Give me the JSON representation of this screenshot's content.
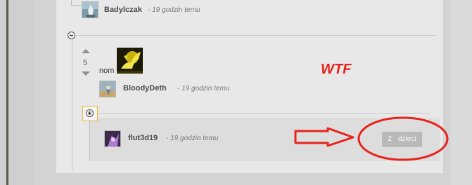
{
  "comments": {
    "top": {
      "author": "Badylczak",
      "time": "- 19 godzin temu"
    },
    "parent": {
      "score": "5",
      "text": "nom",
      "author": "BloodyDeth",
      "time": "- 19 godzin temu"
    },
    "child": {
      "author": "flut3d19",
      "time": "- 19 godzin temu",
      "children_count": "2",
      "children_label": "dzieci"
    }
  },
  "annotation": {
    "text": "WTF",
    "color": "#e8231d"
  },
  "icons": {
    "collapse": "minus-circle-icon",
    "expand": "plus-circle-icon",
    "vote_up": "chevron-up-icon",
    "vote_down": "chevron-down-icon",
    "arrow": "right-arrow-icon"
  }
}
